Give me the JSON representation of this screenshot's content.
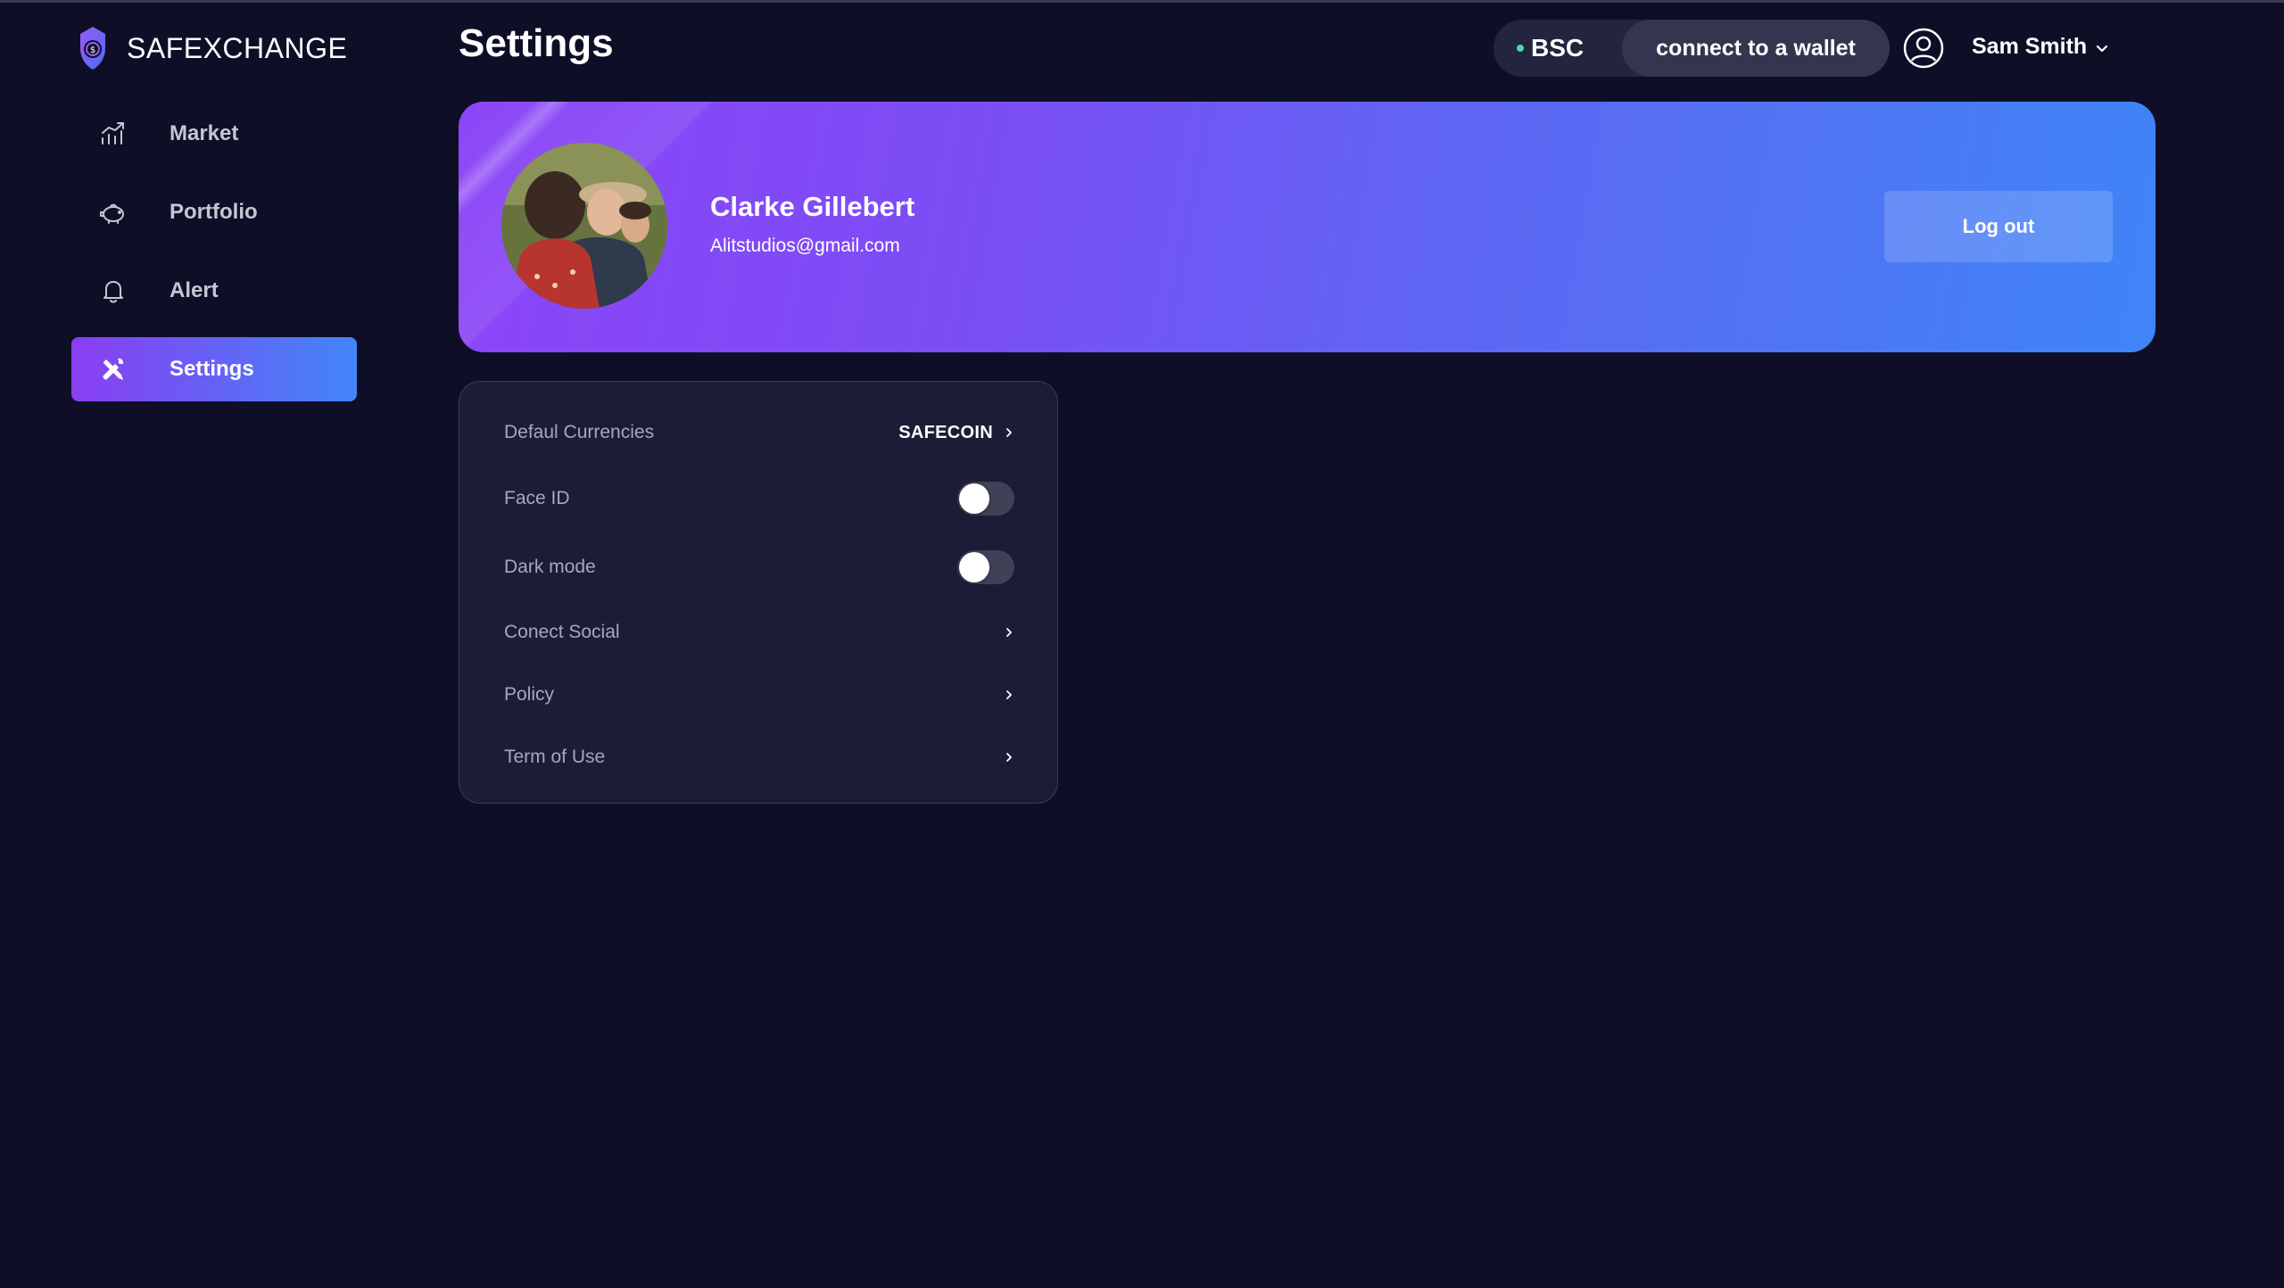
{
  "app": {
    "name": "SAFEXCHANGE"
  },
  "sidebar": {
    "items": [
      {
        "label": "Market",
        "icon": "chart-up-icon",
        "active": false
      },
      {
        "label": "Portfolio",
        "icon": "piggy-bank-icon",
        "active": false
      },
      {
        "label": "Alert",
        "icon": "bell-icon",
        "active": false
      },
      {
        "label": "Settings",
        "icon": "tools-icon",
        "active": true
      }
    ]
  },
  "header": {
    "title": "Settings",
    "network": "BSC",
    "wallet_button": "connect to a wallet",
    "user_name": "Sam Smith"
  },
  "profile": {
    "name": "Clarke Gillebert",
    "email": "Alitstudios@gmail.com",
    "logout_label": "Log out"
  },
  "settings": {
    "default_currencies": {
      "label": "Defaul Currencies",
      "value": "SAFECOIN"
    },
    "face_id": {
      "label": "Face ID",
      "enabled": false
    },
    "dark_mode": {
      "label": "Dark mode",
      "enabled": false
    },
    "connect_social": {
      "label": "Conect Social"
    },
    "policy": {
      "label": "Policy"
    },
    "terms": {
      "label": "Term of Use"
    }
  },
  "colors": {
    "background": "#0e0f27",
    "card": "#1b1d37",
    "accent_purple": "#8a3df2",
    "accent_blue": "#4186f8",
    "network_dot": "#4cd9b0"
  }
}
